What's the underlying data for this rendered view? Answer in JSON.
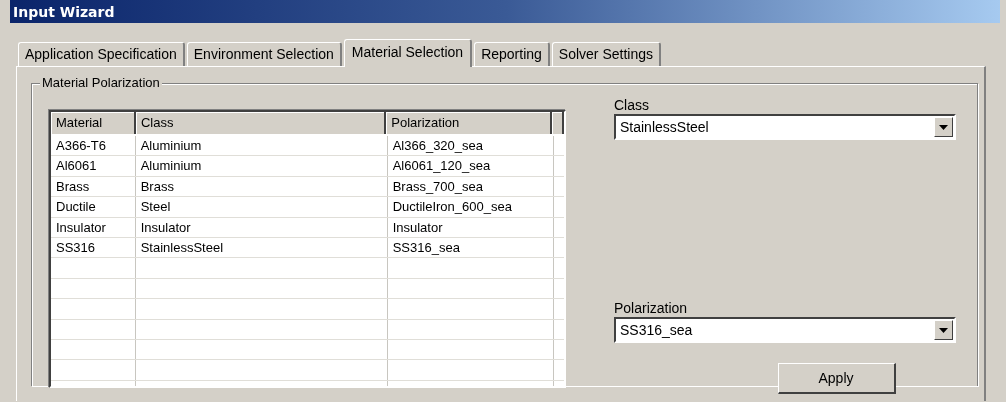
{
  "window": {
    "title": "Input Wizard"
  },
  "tabs": [
    {
      "label": "Application Specification",
      "selected": false
    },
    {
      "label": "Environment Selection",
      "selected": false
    },
    {
      "label": "Material Selection",
      "selected": true
    },
    {
      "label": "Reporting",
      "selected": false
    },
    {
      "label": "Solver Settings",
      "selected": false
    }
  ],
  "group": {
    "title": "Material Polarization"
  },
  "table": {
    "columns": [
      "Material",
      "Class",
      "Polarization"
    ],
    "rows": [
      [
        "A366-T6",
        "Aluminium",
        "Al366_320_sea"
      ],
      [
        "Al6061",
        "Aluminium",
        "Al6061_120_sea"
      ],
      [
        "Brass",
        "Brass",
        "Brass_700_sea"
      ],
      [
        "Ductile",
        "Steel",
        "DuctileIron_600_sea"
      ],
      [
        "Insulator",
        "Insulator",
        "Insulator"
      ],
      [
        "SS316",
        "StainlessSteel",
        "SS316_sea"
      ]
    ]
  },
  "class_field": {
    "label": "Class",
    "value": "StainlessSteel"
  },
  "polarization_field": {
    "label": "Polarization",
    "value": "SS316_sea"
  },
  "apply_button": {
    "label": "Apply"
  }
}
